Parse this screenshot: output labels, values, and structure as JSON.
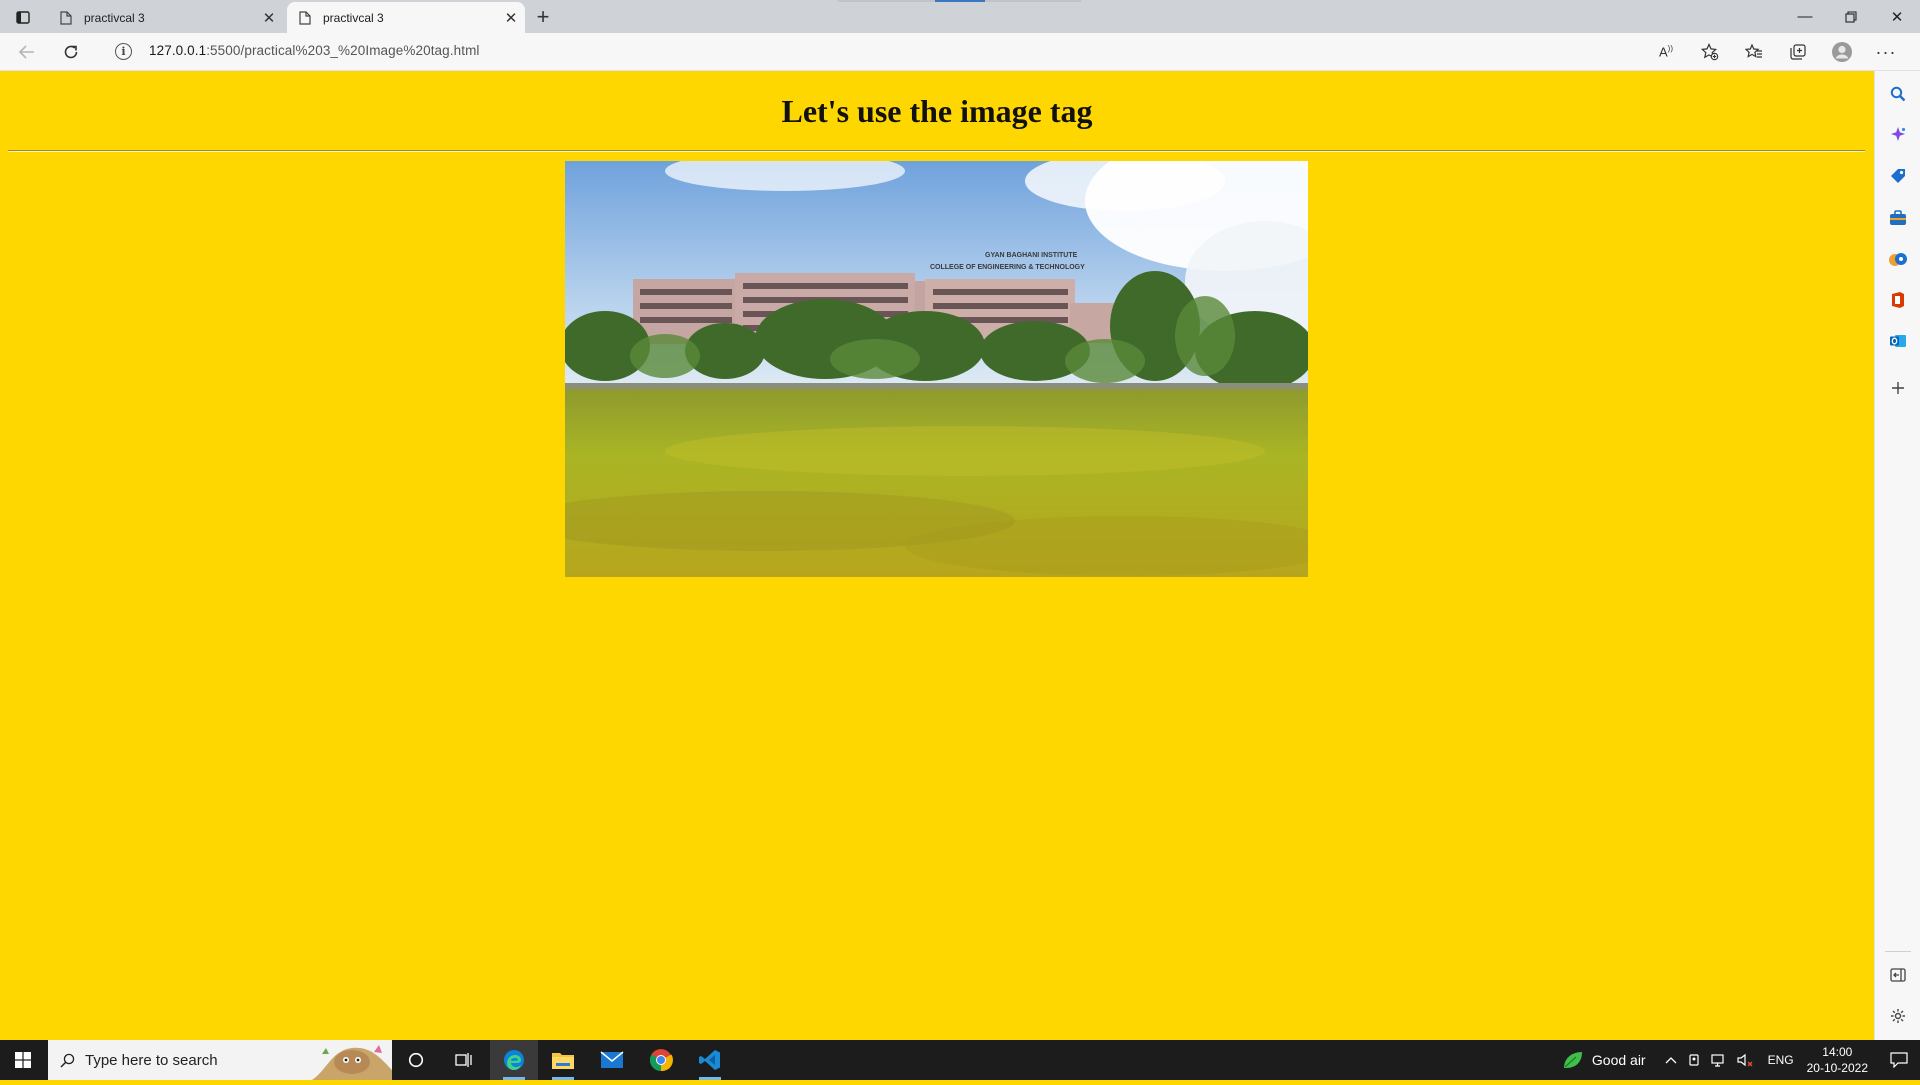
{
  "browser": {
    "tabs": [
      {
        "title": "practivcal 3",
        "active": false
      },
      {
        "title": "practivcal 3",
        "active": true
      }
    ],
    "address": {
      "host": "127.0.0.1",
      "rest": ":5500/practical%203_%20Image%20tag.html"
    },
    "toolbar_icons": [
      "read-aloud-icon",
      "add-favorite-icon",
      "favorites-icon",
      "collections-icon",
      "profile-icon",
      "more-icon"
    ],
    "sidebar_icons": [
      "search-icon",
      "copilot-icon",
      "shopping-icon",
      "tools-icon",
      "games-icon",
      "office-icon",
      "outlook-icon",
      "add-icon",
      "sidebar-collapse-icon",
      "settings-icon"
    ]
  },
  "page": {
    "heading": "Let's use the image tag",
    "background": "#ffd700",
    "image_alt": "College campus building with green lawn"
  },
  "taskbar": {
    "search_placeholder": "Type here to search",
    "apps": [
      "cortana-icon",
      "task-view-icon",
      "edge-icon",
      "file-explorer-icon",
      "mail-icon",
      "chrome-icon",
      "vscode-icon"
    ],
    "weather": "Good air",
    "language": "ENG",
    "time": "14:00",
    "date": "20-10-2022"
  }
}
